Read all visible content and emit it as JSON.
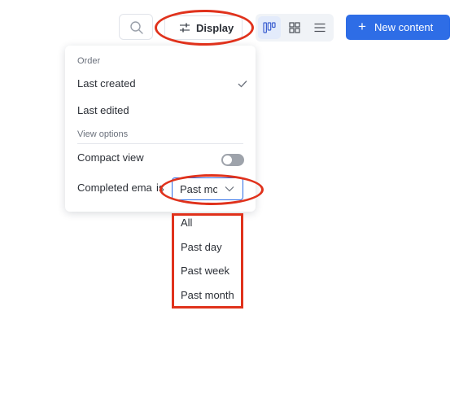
{
  "toolbar": {
    "search_icon": "search-icon",
    "display_label": "Display",
    "display_icon": "sliders-icon",
    "view_buttons": [
      {
        "name": "board-view",
        "icon": "board-icon",
        "active": true
      },
      {
        "name": "grid-view",
        "icon": "grid-icon",
        "active": false
      },
      {
        "name": "list-view",
        "icon": "list-icon",
        "active": false
      }
    ],
    "new_content_label": "New content",
    "new_content_icon": "plus-icon"
  },
  "display_panel": {
    "order_title": "Order",
    "order_options": [
      {
        "label": "Last created",
        "selected": true
      },
      {
        "label": "Last edited",
        "selected": false
      }
    ],
    "view_options_title": "View options",
    "compact_view_label": "Compact view",
    "compact_view_on": false,
    "completed_label": "Completed ema",
    "completed_suffix": "is",
    "completed_value": "Past mo"
  },
  "completed_dropdown": {
    "options": [
      "All",
      "Past day",
      "Past week",
      "Past month"
    ]
  },
  "colors": {
    "accent": "#2e6de6",
    "highlight": "#e0321c",
    "toggle_off": "#9ea3ab"
  }
}
